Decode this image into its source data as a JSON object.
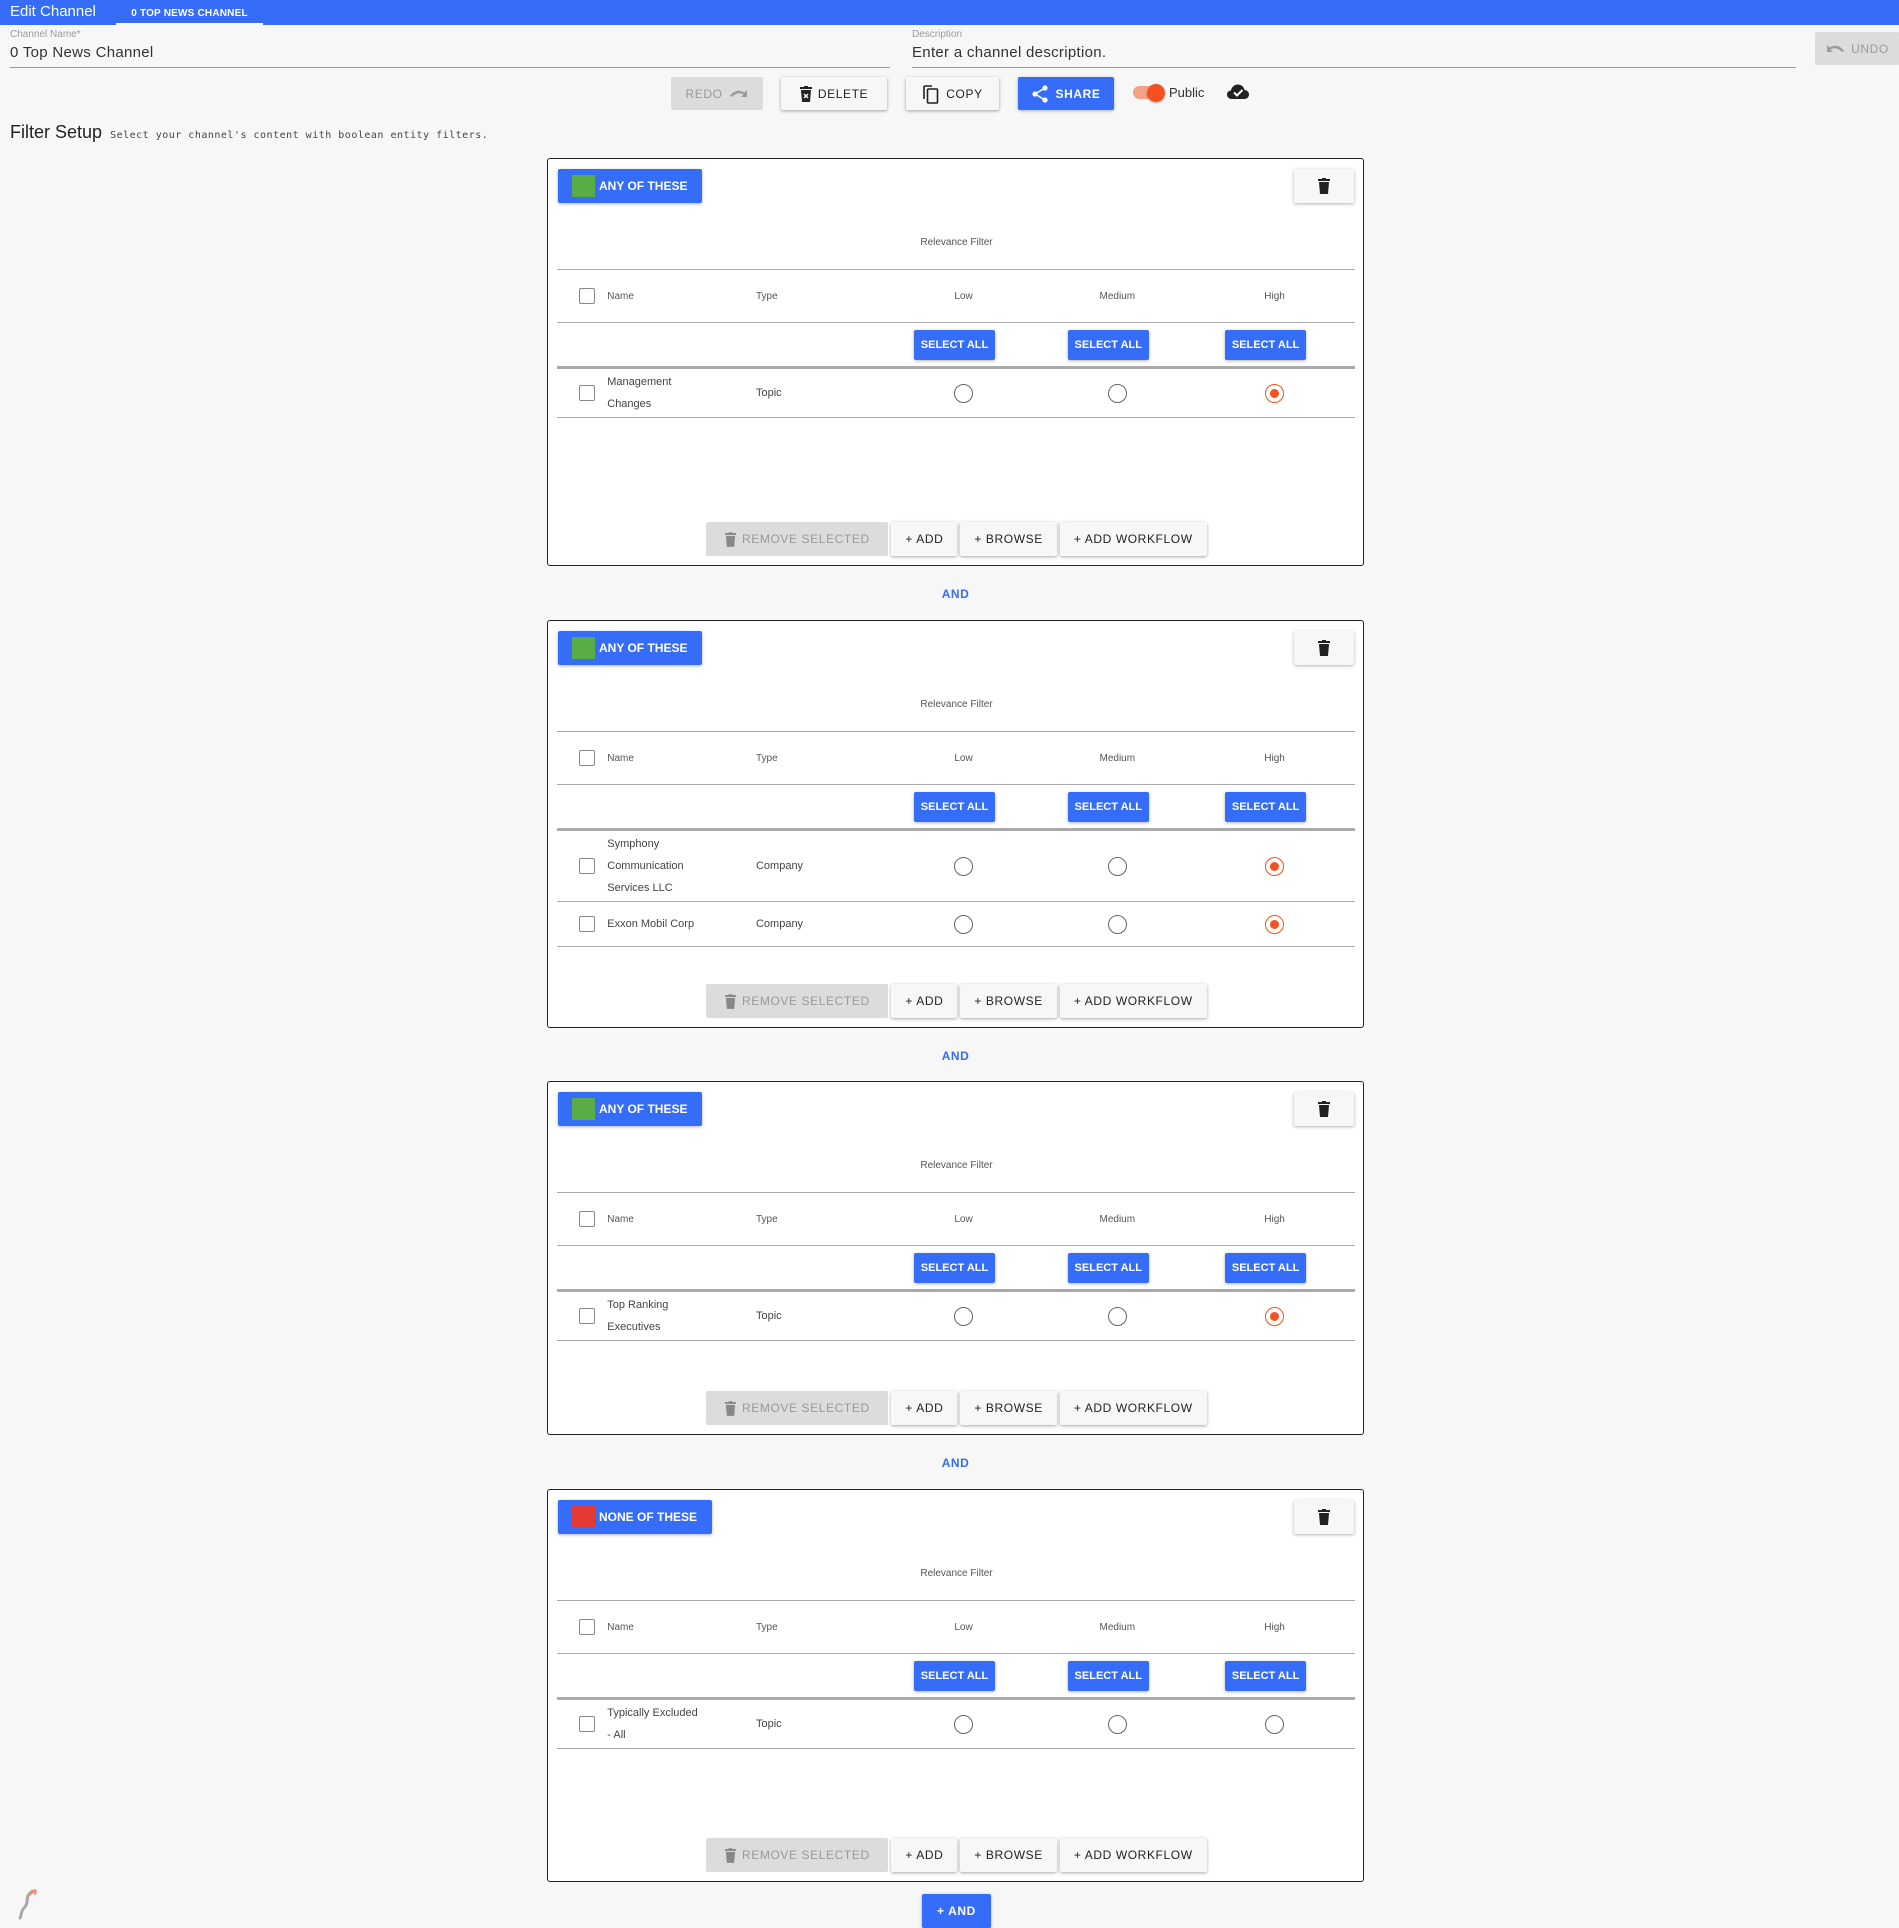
{
  "app": {
    "title": "Edit Channel",
    "tab": "0 TOP NEWS CHANNEL"
  },
  "fields": {
    "channel_name_label": "Channel Name*",
    "channel_name_value": "0 Top News Channel",
    "description_label": "Description",
    "description_placeholder": "Enter a channel description."
  },
  "toolbar": {
    "undo": "UNDO",
    "redo": "REDO",
    "delete": "DELETE",
    "copy": "COPY",
    "share": "SHARE",
    "public_label": "Public",
    "public_on": true
  },
  "filter_setup": {
    "title": "Filter Setup",
    "subtitle": "Select your channel's content with boolean entity filters."
  },
  "table_headers": {
    "relevance": "Relevance Filter",
    "name": "Name",
    "type": "Type",
    "low": "Low",
    "medium": "Medium",
    "high": "High",
    "select_all": "SELECT ALL"
  },
  "card_actions": {
    "remove_selected": "REMOVE SELECTED",
    "add": "+ ADD",
    "browse": "+ BROWSE",
    "add_workflow": "+ ADD WORKFLOW"
  },
  "connector_label": "AND",
  "add_and_label": "+ AND",
  "colors": {
    "accent": "#356cf8",
    "any_swatch": "#5aac44",
    "none_swatch": "#e53935",
    "radio_selected": "#f4511e"
  },
  "filters": [
    {
      "mode": "ANY OF THESE",
      "swatch": "any",
      "rows": [
        {
          "name_lines": [
            "Management",
            "Changes"
          ],
          "type": "Topic",
          "relevance": "High"
        }
      ]
    },
    {
      "mode": "ANY OF THESE",
      "swatch": "any",
      "rows": [
        {
          "name_lines": [
            "Symphony",
            "Communication",
            "Services LLC"
          ],
          "type": "Company",
          "relevance": "High"
        },
        {
          "name_lines": [
            "Exxon Mobil Corp"
          ],
          "type": "Company",
          "relevance": "High"
        }
      ]
    },
    {
      "mode": "ANY OF THESE",
      "swatch": "any",
      "rows": [
        {
          "name_lines": [
            "Top Ranking",
            "Executives"
          ],
          "type": "Topic",
          "relevance": "High"
        }
      ]
    },
    {
      "mode": "NONE OF THESE",
      "swatch": "none",
      "rows": [
        {
          "name_lines": [
            "Typically Excluded",
            "- All"
          ],
          "type": "Topic",
          "relevance": null
        }
      ]
    }
  ]
}
